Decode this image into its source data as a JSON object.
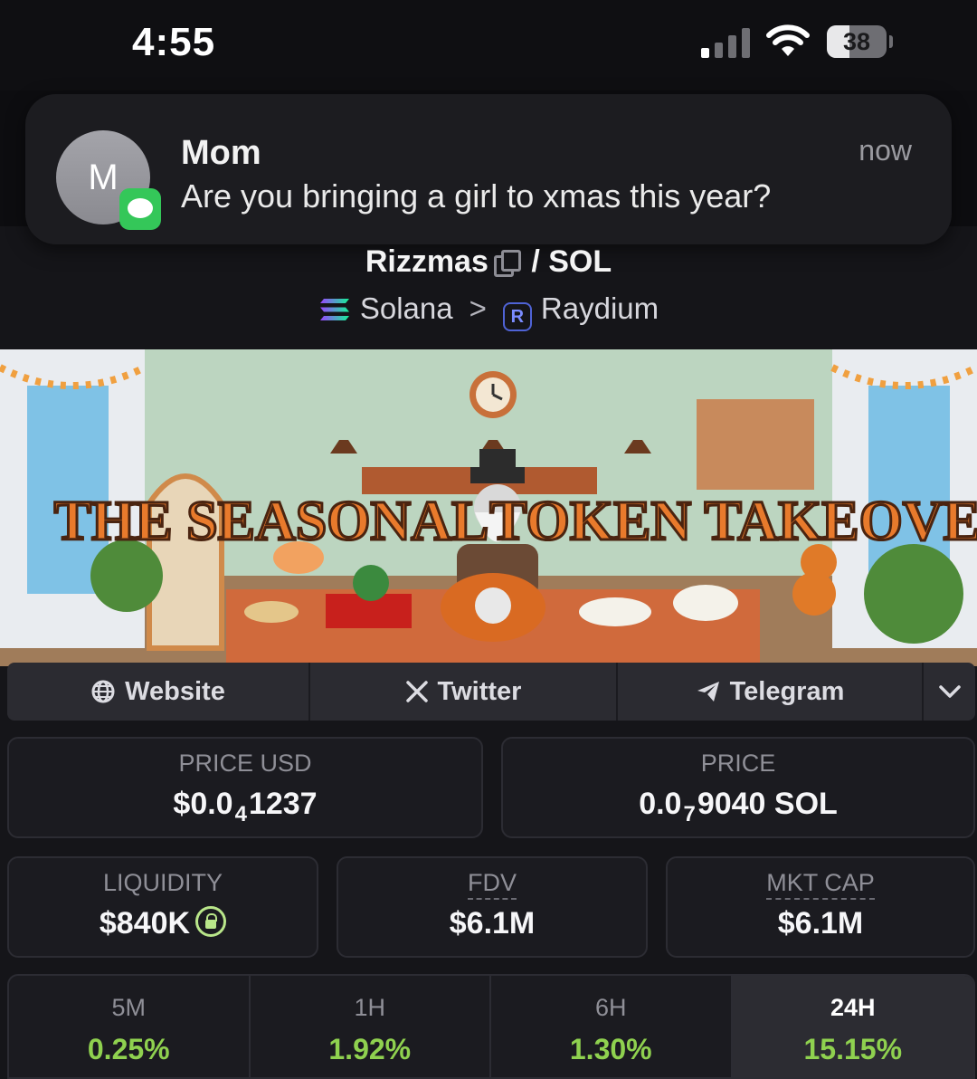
{
  "status_bar": {
    "time": "4:55",
    "battery_percent": "38",
    "battery_level": 0.38
  },
  "notification": {
    "avatar_initial": "M",
    "sender": "Mom",
    "time": "now",
    "message": "Are you bringing a girl to xmas this year?",
    "app_icon": "messages-icon"
  },
  "pair": {
    "base": "Rizzmas",
    "separator": "/",
    "quote": "SOL",
    "chain": "Solana",
    "crumb_separator": ">",
    "dex": "Raydium",
    "dex_icon_letter": "R"
  },
  "banner": {
    "text_left": "THE SEASONAL",
    "text_right": "TOKEN TAKEOVER"
  },
  "links": {
    "website": "Website",
    "twitter": "Twitter",
    "telegram": "Telegram"
  },
  "stats": {
    "price_usd": {
      "label": "PRICE USD",
      "prefix": "$0.0",
      "sub": "4",
      "digits": "1237"
    },
    "price": {
      "label": "PRICE",
      "prefix": "0.0",
      "sub": "7",
      "digits": "9040 SOL"
    },
    "liquidity": {
      "label": "LIQUIDITY",
      "value": "$840K"
    },
    "fdv": {
      "label": "FDV",
      "value": "$6.1M"
    },
    "mkt_cap": {
      "label": "MKT CAP",
      "value": "$6.1M"
    }
  },
  "timeframes": [
    {
      "label": "5M",
      "value": "0.25%"
    },
    {
      "label": "1H",
      "value": "1.92%"
    },
    {
      "label": "6H",
      "value": "1.30%"
    },
    {
      "label": "24H",
      "value": "15.15%"
    }
  ],
  "colors": {
    "positive": "#8fd14f",
    "messages_green": "#34c759",
    "raydium_accent": "#4f63d6"
  }
}
